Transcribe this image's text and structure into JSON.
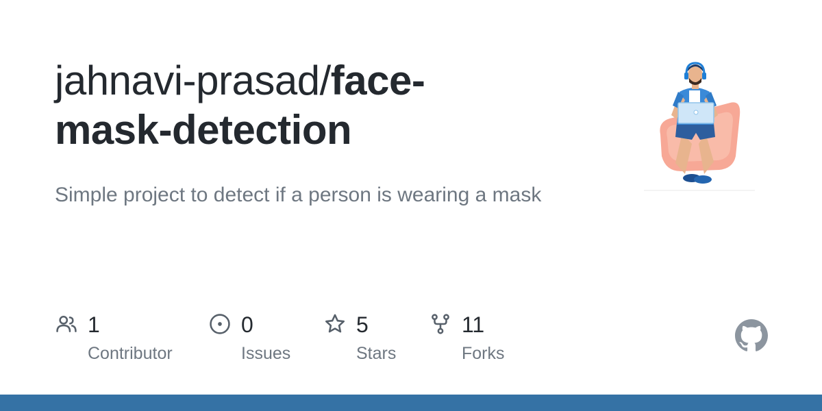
{
  "repo": {
    "owner": "jahnavi-prasad/",
    "name": "face-mask-detection",
    "description": "Simple project to detect if a person is wearing a mask"
  },
  "stats": [
    {
      "icon": "people-icon",
      "value": "1",
      "label": "Contributor"
    },
    {
      "icon": "issue-opened-icon",
      "value": "0",
      "label": "Issues"
    },
    {
      "icon": "star-icon",
      "value": "5",
      "label": "Stars"
    },
    {
      "icon": "repo-forked-icon",
      "value": "11",
      "label": "Forks"
    }
  ],
  "language_bar": {
    "color": "#3572a5"
  },
  "colors": {
    "title": "#24292f",
    "muted": "#6e7781",
    "icon": "#57606a",
    "logo": "#8c959f"
  }
}
